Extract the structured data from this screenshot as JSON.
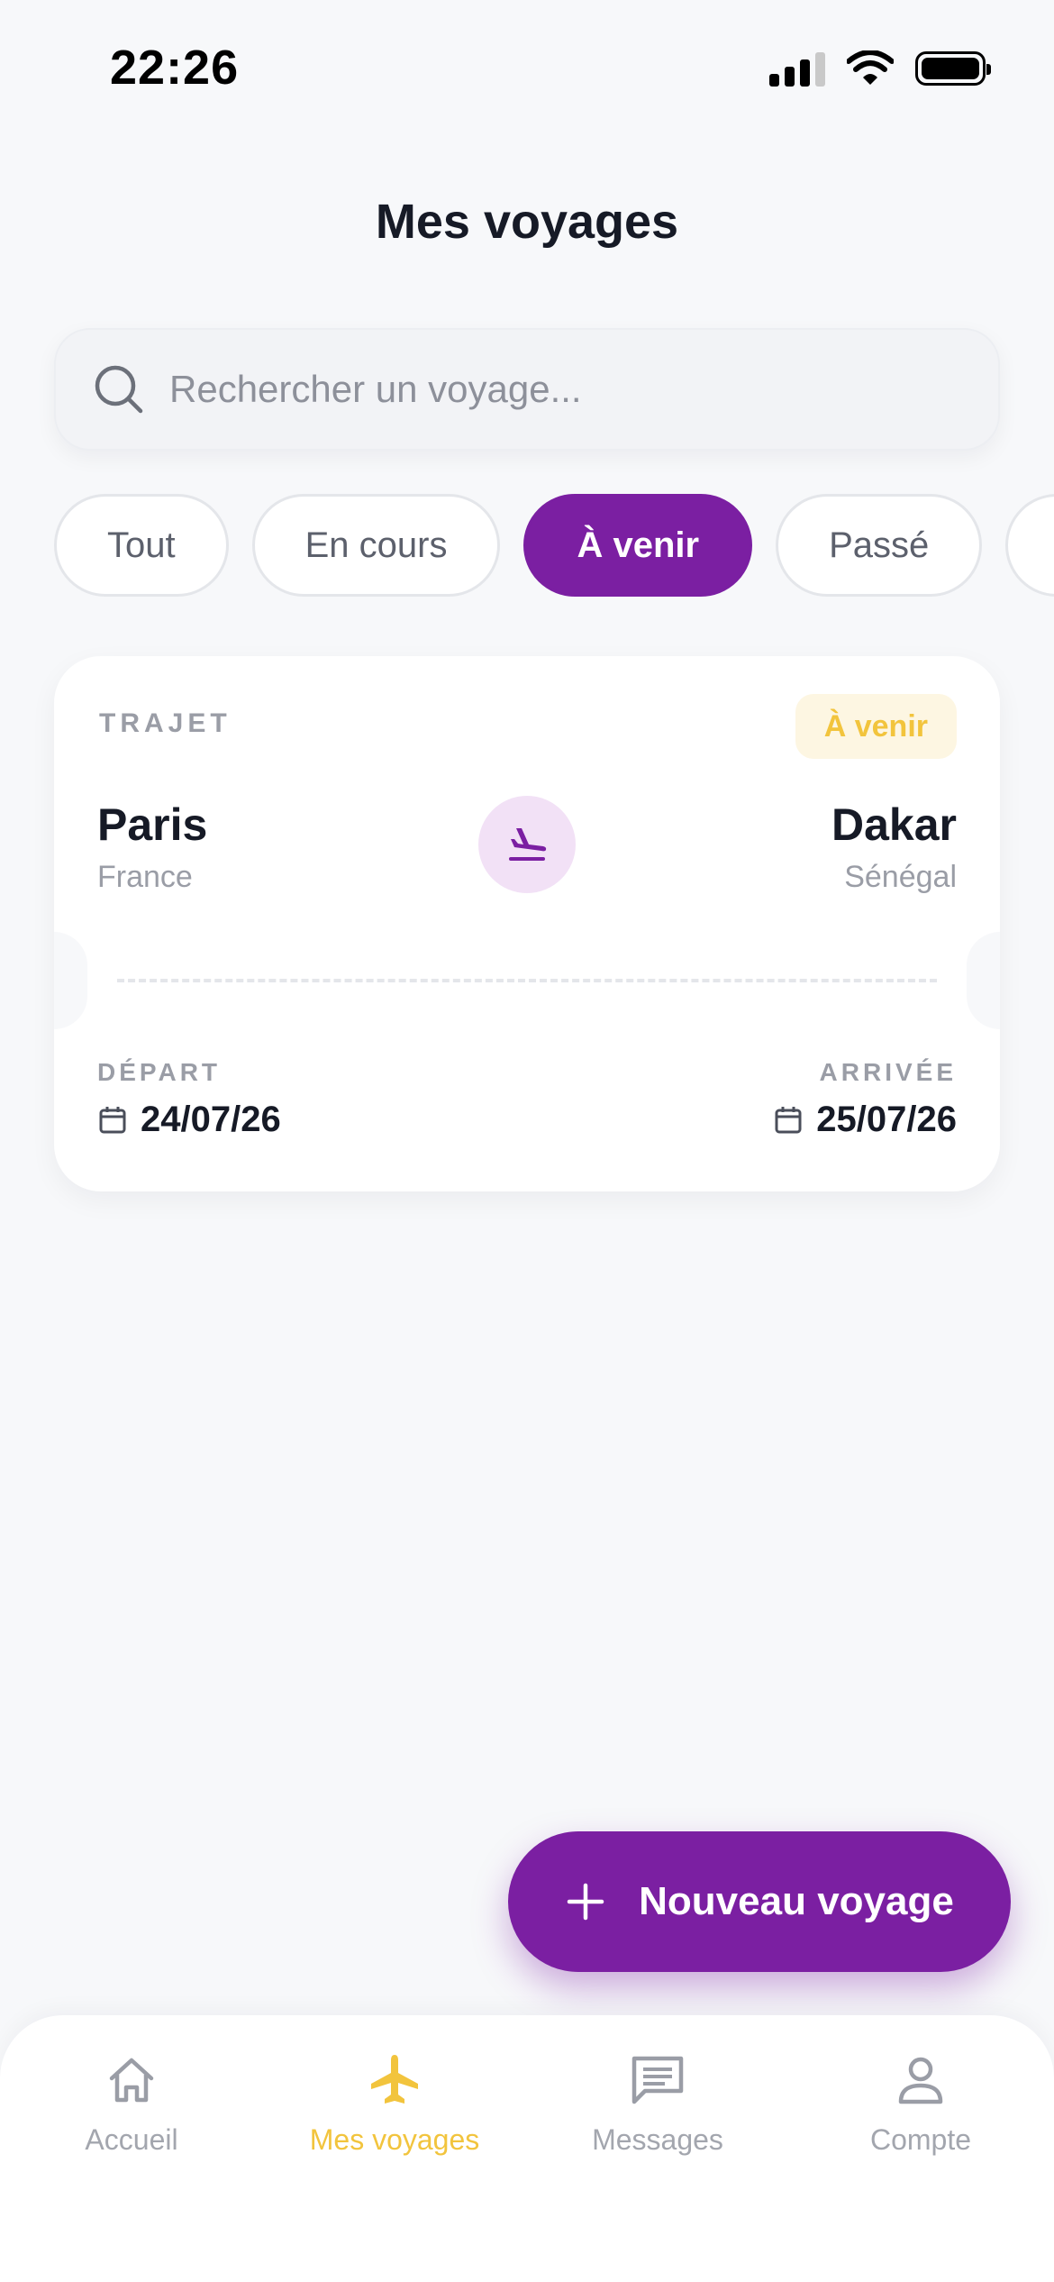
{
  "status_bar": {
    "time": "22:26"
  },
  "header": {
    "title": "Mes voyages"
  },
  "search": {
    "placeholder": "Rechercher un voyage..."
  },
  "tabs": [
    {
      "label": "Tout",
      "active": false
    },
    {
      "label": "En cours",
      "active": false
    },
    {
      "label": "À venir",
      "active": true
    },
    {
      "label": "Passé",
      "active": false
    },
    {
      "label": "",
      "active": false
    }
  ],
  "trip": {
    "label": "TRAJET",
    "status": "À venir",
    "from": {
      "city": "Paris",
      "country": "France"
    },
    "to": {
      "city": "Dakar",
      "country": "Sénégal"
    },
    "departure": {
      "label": "DÉPART",
      "date": "24/07/26"
    },
    "arrival": {
      "label": "ARRIVÉE",
      "date": "25/07/26"
    }
  },
  "fab": {
    "label": "Nouveau voyage"
  },
  "nav": [
    {
      "label": "Accueil",
      "icon": "home-icon",
      "active": false
    },
    {
      "label": "Mes voyages",
      "icon": "airplane-icon",
      "active": true
    },
    {
      "label": "Messages",
      "icon": "message-icon",
      "active": false
    },
    {
      "label": "Compte",
      "icon": "user-icon",
      "active": false
    }
  ],
  "colors": {
    "primary": "#7b1fa2",
    "accent": "#f2c43d",
    "background": "#f7f8fa",
    "badge_bg": "#fdf6e2",
    "plane_circle_bg": "#f2e1f6"
  }
}
